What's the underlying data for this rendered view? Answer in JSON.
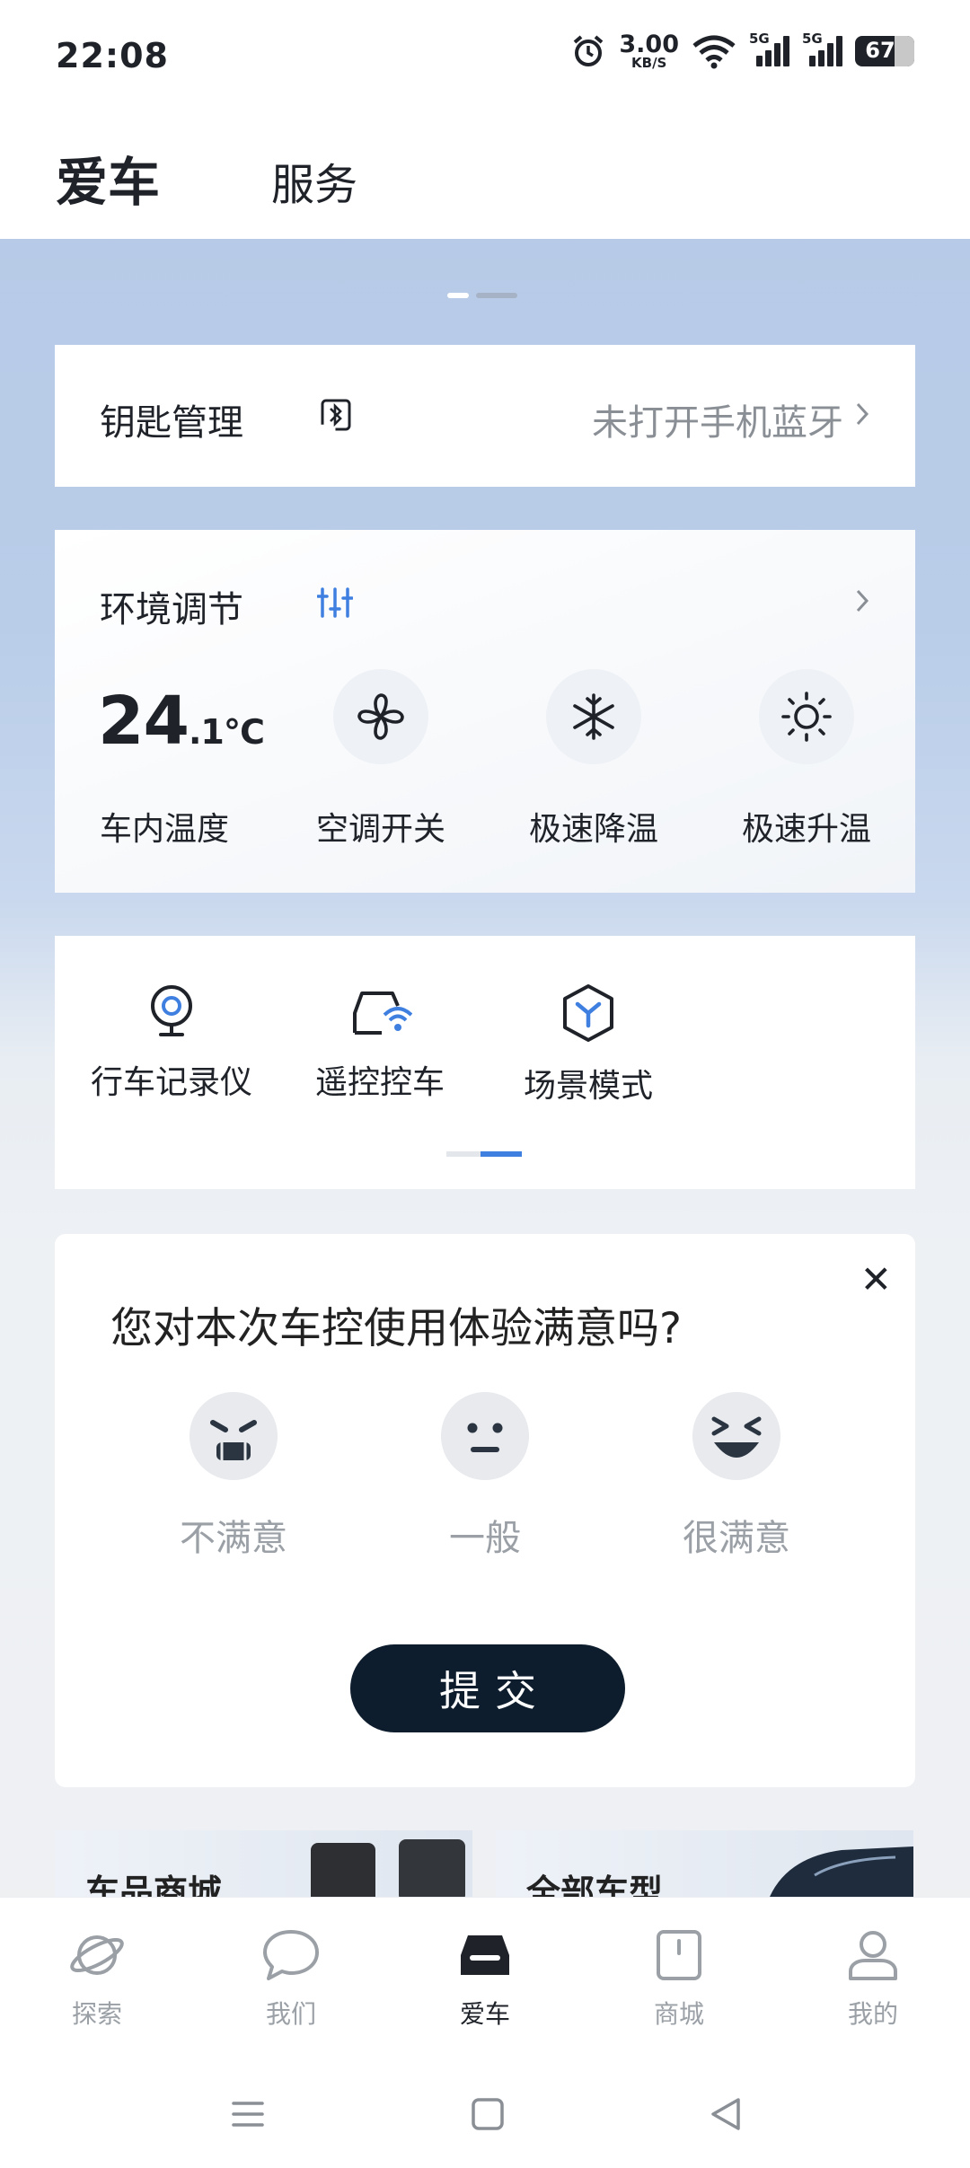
{
  "status_bar": {
    "time": "22:08",
    "net_speed": "3.00",
    "net_speed_unit": "KB/S",
    "sim1_label": "5G",
    "sim2_label": "5G",
    "battery": "67"
  },
  "header": {
    "active_tab": "爱车",
    "other_tab": "服务"
  },
  "key_card": {
    "title": "钥匙管理",
    "status": "未打开手机蓝牙"
  },
  "env_card": {
    "title": "环境调节",
    "temp_int": "24",
    "temp_dec": ".1℃",
    "controls": [
      {
        "label": "车内温度",
        "icon": "temperature"
      },
      {
        "label": "空调开关",
        "icon": "fan-icon"
      },
      {
        "label": "极速降温",
        "icon": "snowflake-icon"
      },
      {
        "label": "极速升温",
        "icon": "sun-icon"
      }
    ]
  },
  "quick_actions": [
    {
      "label": "行车记录仪",
      "icon": "dashcam-icon"
    },
    {
      "label": "遥控控车",
      "icon": "remote-car-icon"
    },
    {
      "label": "场景模式",
      "icon": "scene-icon"
    }
  ],
  "survey": {
    "question": "您对本次车控使用体验满意吗?",
    "options": [
      {
        "label": "不满意",
        "icon": "angry-face-icon"
      },
      {
        "label": "一般",
        "icon": "neutral-face-icon"
      },
      {
        "label": "很满意",
        "icon": "happy-face-icon"
      }
    ],
    "submit": "提交"
  },
  "promos": [
    {
      "label": "车品商城 ,"
    },
    {
      "label": "全部车型 ,"
    }
  ],
  "bottom_nav": [
    {
      "label": "探索",
      "icon": "planet-icon"
    },
    {
      "label": "我们",
      "icon": "chat-bubble-icon"
    },
    {
      "label": "爱车",
      "icon": "car-icon",
      "active": true
    },
    {
      "label": "商城",
      "icon": "shop-icon"
    },
    {
      "label": "我的",
      "icon": "profile-icon"
    }
  ],
  "colors": {
    "accent_blue": "#3e7fe0",
    "dark_button": "#0e1d2d",
    "muted_text": "#8a8f96"
  }
}
